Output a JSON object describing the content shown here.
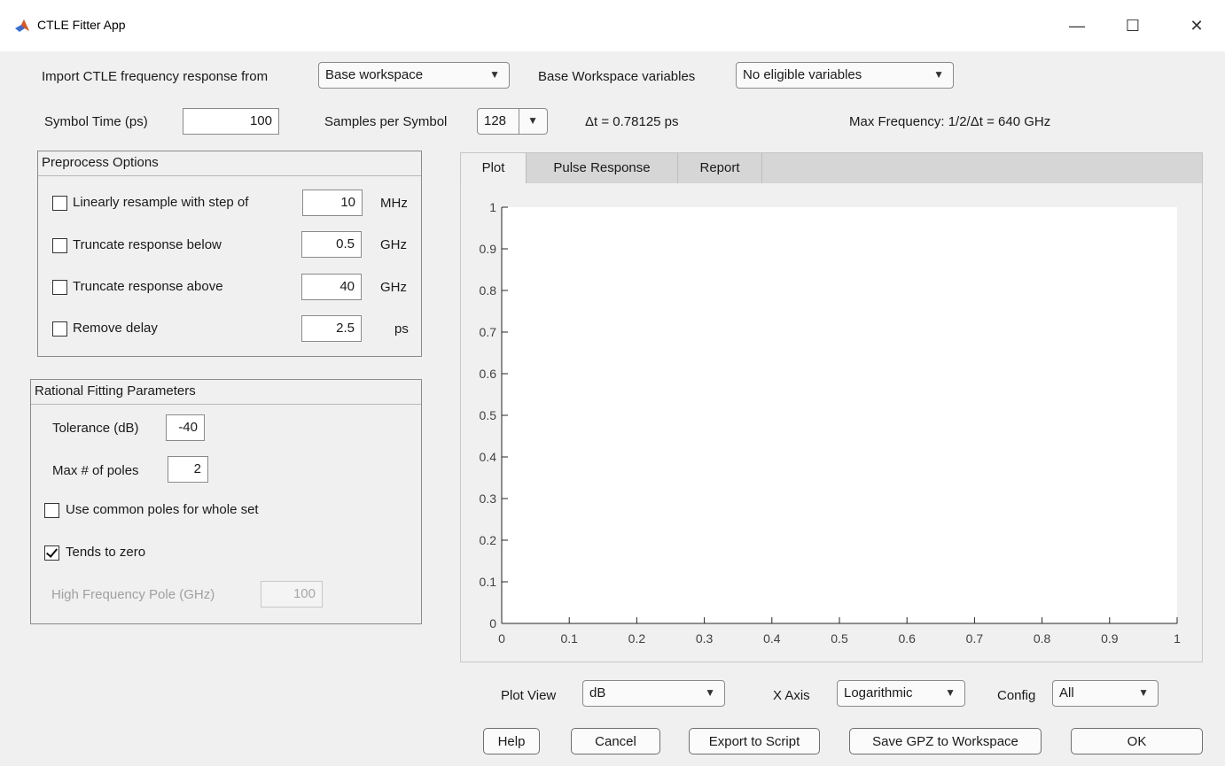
{
  "window": {
    "title": "CTLE Fitter App",
    "minimize_glyph": "—",
    "maximize_glyph": "☐",
    "close_glyph": "✕"
  },
  "import": {
    "label": "Import CTLE frequency response from",
    "source_value": "Base workspace",
    "vars_label": "Base Workspace variables",
    "vars_value": "No eligible variables"
  },
  "symbol": {
    "time_label": "Symbol Time (ps)",
    "time_value": "100",
    "sps_label": "Samples per Symbol",
    "sps_value": "128",
    "dt_text": "Δt = 0.78125 ps",
    "maxfreq_text": "Max Frequency: 1/2/Δt = 640 GHz"
  },
  "preprocess": {
    "title": "Preprocess Options",
    "rows": [
      {
        "label": "Linearly resample with step of",
        "value": "10",
        "unit": "MHz",
        "checked": false
      },
      {
        "label": "Truncate response below",
        "value": "0.5",
        "unit": "GHz",
        "checked": false
      },
      {
        "label": "Truncate response above",
        "value": "40",
        "unit": "GHz",
        "checked": false
      },
      {
        "label": "Remove delay",
        "value": "2.5",
        "unit": "ps",
        "checked": false
      }
    ]
  },
  "fitting": {
    "title": "Rational Fitting Parameters",
    "tolerance_label": "Tolerance (dB)",
    "tolerance_value": "-40",
    "maxpoles_label": "Max # of poles",
    "maxpoles_value": "2",
    "common_poles_label": "Use common poles for whole set",
    "common_poles_checked": false,
    "tends_zero_label": "Tends to zero",
    "tends_zero_checked": true,
    "hf_pole_label": "High Frequency Pole (GHz)",
    "hf_pole_value": "100"
  },
  "tabs": [
    {
      "label": "Plot",
      "active": true
    },
    {
      "label": "Pulse Response",
      "active": false
    },
    {
      "label": "Report",
      "active": false
    }
  ],
  "chart_data": {
    "type": "line",
    "series": [],
    "xlim": [
      0,
      1
    ],
    "ylim": [
      0,
      1
    ],
    "x_ticks": [
      "0",
      "0.1",
      "0.2",
      "0.3",
      "0.4",
      "0.5",
      "0.6",
      "0.7",
      "0.8",
      "0.9",
      "1"
    ],
    "y_ticks": [
      "0",
      "0.1",
      "0.2",
      "0.3",
      "0.4",
      "0.5",
      "0.6",
      "0.7",
      "0.8",
      "0.9",
      "1"
    ],
    "grid": false
  },
  "controls": {
    "plot_view_label": "Plot View",
    "plot_view_value": "dB",
    "xaxis_label": "X Axis",
    "xaxis_value": "Logarithmic",
    "config_label": "Config",
    "config_value": "All"
  },
  "buttons": {
    "help": "Help",
    "cancel": "Cancel",
    "export": "Export to Script",
    "save_gpz": "Save GPZ to Workspace",
    "ok": "OK"
  },
  "colors": {
    "app_icon_orange": "#e2561c",
    "app_icon_blue": "#3a6fd0"
  }
}
